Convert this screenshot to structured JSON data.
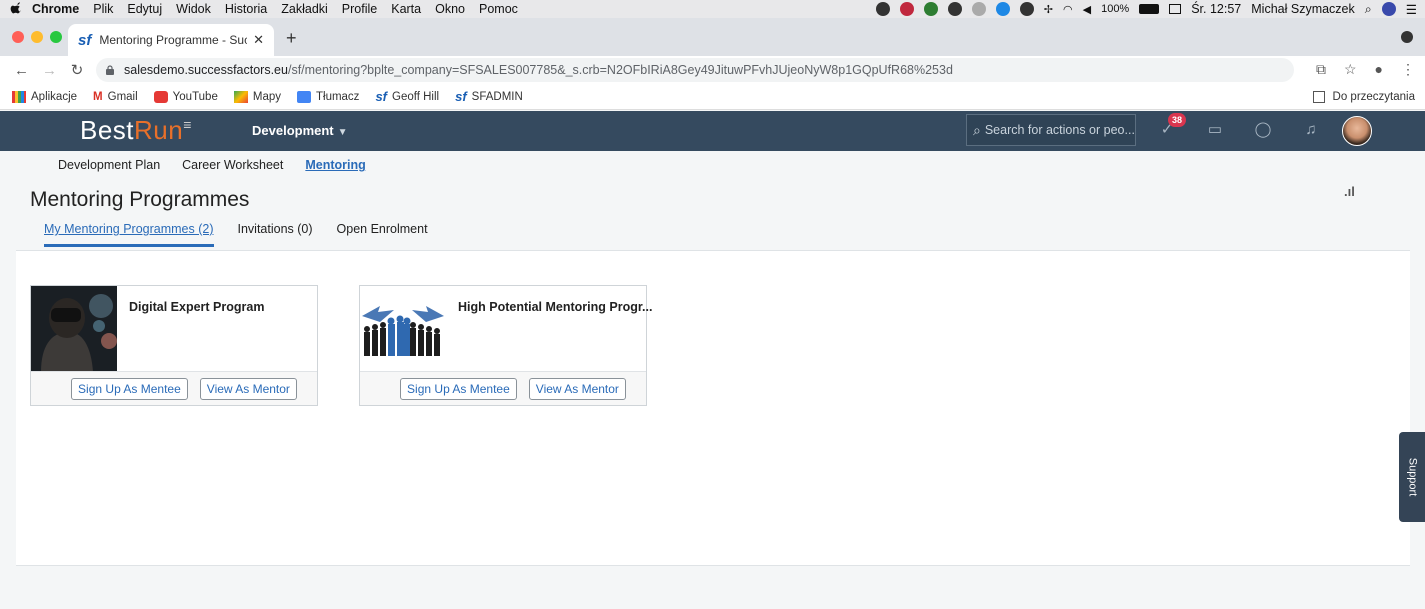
{
  "macbar": {
    "app": "Chrome",
    "menus": [
      "Plik",
      "Edytuj",
      "Widok",
      "Historia",
      "Zakładki",
      "Profile",
      "Karta",
      "Okno",
      "Pomoc"
    ],
    "battery": "100%",
    "datetime": "Śr. 12:57",
    "user": "Michał Szymaczek"
  },
  "browser": {
    "tab_title": "Mentoring Programme - Succe",
    "url_host": "salesdemo.successfactors.eu",
    "url_path": "/sf/mentoring?bplte_company=SFSALES007785&_s.crb=N2OFbIRiA8Gey49JituwPFvhJUjeoNyW8p1GQpUfR68%253d",
    "bookmarks": [
      "Aplikacje",
      "Gmail",
      "YouTube",
      "Mapy",
      "Tłumacz",
      "Geoff Hill",
      "SFADMIN"
    ],
    "reading_list": "Do przeczytania"
  },
  "sf": {
    "brand_a": "Best",
    "brand_b": "Run",
    "module": "Development",
    "search_placeholder": "Search for actions or peo...",
    "notification_badge": "38",
    "subnav": [
      "Development Plan",
      "Career Worksheet",
      "Mentoring"
    ],
    "page_title": "Mentoring Programmes",
    "tabs": [
      "My Mentoring Programmes (2)",
      "Invitations (0)",
      "Open Enrolment"
    ],
    "cards": [
      {
        "title": "Digital Expert Program",
        "mentee_btn": "Sign Up As Mentee",
        "mentor_btn": "View As Mentor"
      },
      {
        "title": "High Potential Mentoring Progr...",
        "mentee_btn": "Sign Up As Mentee",
        "mentor_btn": "View As Mentor"
      }
    ],
    "support": "Support"
  },
  "colors": {
    "header_bg": "#354a5f",
    "accent_blue": "#2a6bb8",
    "brand_orange": "#e8702a"
  }
}
